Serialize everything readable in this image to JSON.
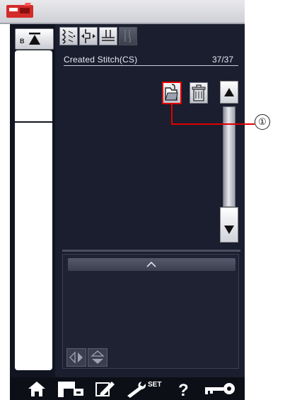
{
  "header": {
    "icon": "machine-icon"
  },
  "sidebar": {
    "button_label": "B",
    "icon": "up-arrow-icon"
  },
  "toolbar": {
    "icons": [
      "stitch-pattern-icon",
      "stitch-adjust-icon",
      "stitch-combine-icon",
      "needle-icon"
    ]
  },
  "main": {
    "title": "Created Stitch(CS)",
    "count": "37/37",
    "actions": [
      "open-file-icon",
      "delete-icon"
    ],
    "scroll": {
      "up_icon": "scroll-up-icon",
      "down_icon": "scroll-down-icon"
    }
  },
  "callout": {
    "number": "①"
  },
  "bottom_panel": {
    "expand_icon": "chevron-up-icon",
    "buttons": [
      "mirror-icon",
      "flip-icon"
    ]
  },
  "bottom_nav": {
    "items": [
      "home-icon",
      "machine-settings-icon",
      "pattern-edit-icon",
      "set-tool-icon",
      "help-icon",
      "lock-key-icon"
    ],
    "set_label": "SET",
    "help_label": "?"
  },
  "colors": {
    "panel": "#1a1e2e",
    "callout_line": "#e00000",
    "text": "#e9ecf5"
  }
}
